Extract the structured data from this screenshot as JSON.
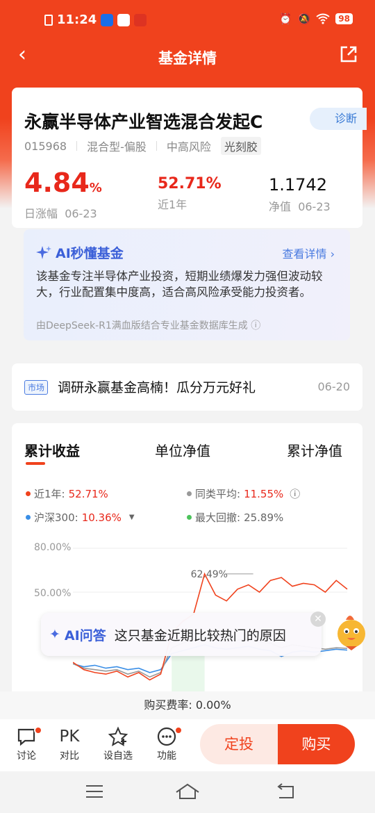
{
  "status": {
    "time": "11:24",
    "battery": "98"
  },
  "nav": {
    "title": "基金详情"
  },
  "fund": {
    "name": "永赢半导体产业智选混合发起C",
    "diag_label": "诊断",
    "code": "015968",
    "type": "混合型-偏股",
    "risk": "中高风险",
    "tag": "光刻胶",
    "daily_change": "4.84",
    "daily_change_unit": "%",
    "daily_label": "日涨幅",
    "daily_date": "06-23",
    "year_return": "52.71%",
    "year_label": "近1年",
    "nav_value": "1.1742",
    "nav_label": "净值",
    "nav_date": "06-23"
  },
  "ai": {
    "title": "AI秒懂基金",
    "more": "查看详情",
    "text": "该基金专注半导体产业投资，短期业绩爆发力强但波动较大，行业配置集中度高，适合高风险承受能力投资者。",
    "source": "由DeepSeek-R1满血版结合专业基金数据库生成"
  },
  "news": {
    "tag": "市场",
    "text": "调研永赢基金高楠！瓜分万元好礼",
    "date": "06-20"
  },
  "chart_tabs": [
    "累计收益",
    "单位净值",
    "累计净值"
  ],
  "legend": {
    "l1_label": "近1年:",
    "l1_value": "52.71%",
    "l2_label": "同类平均:",
    "l2_value": "11.55%",
    "l3_label": "沪深300:",
    "l3_value": "10.36%",
    "l4_label": "最大回撤:",
    "l4_value": "25.89%"
  },
  "colors": {
    "fund": "#f0421d",
    "peer": "#999999",
    "csi300": "#3a8ee6",
    "drawdown": "#4cc35b"
  },
  "chart_data": {
    "type": "line",
    "yticks": [
      "80.00%",
      "50.00%"
    ],
    "annotation": "62.49%",
    "series": [
      {
        "name": "近1年",
        "values": [
          2,
          -3,
          -5,
          -6,
          -4,
          -8,
          -5,
          -10,
          -6,
          22,
          30,
          35,
          62.49,
          48,
          44,
          52,
          55,
          50,
          58,
          60,
          54,
          56,
          55,
          50,
          58,
          52
        ]
      },
      {
        "name": "同类平均",
        "values": [
          1,
          -2,
          -3,
          -4,
          -3,
          -6,
          -4,
          -8,
          -5,
          12,
          15,
          18,
          20,
          18,
          16,
          17,
          18,
          16,
          15,
          12,
          14,
          13,
          12,
          11,
          12,
          11.55
        ]
      },
      {
        "name": "沪深300",
        "values": [
          1,
          -1,
          0,
          -2,
          -1,
          -3,
          -2,
          -5,
          -3,
          8,
          10,
          12,
          14,
          12,
          11,
          12,
          13,
          11,
          10,
          6,
          9,
          10,
          9,
          10,
          11,
          10.36
        ]
      }
    ]
  },
  "ai_tip": {
    "label": "AI问答",
    "text": "这只基金近期比较热门的原因"
  },
  "fee": "购买费率: 0.00%",
  "bottom": {
    "discuss": "讨论",
    "pk": "PK",
    "compare": "对比",
    "watch": "设自选",
    "func": "功能",
    "sip": "定投",
    "buy": "购买"
  }
}
